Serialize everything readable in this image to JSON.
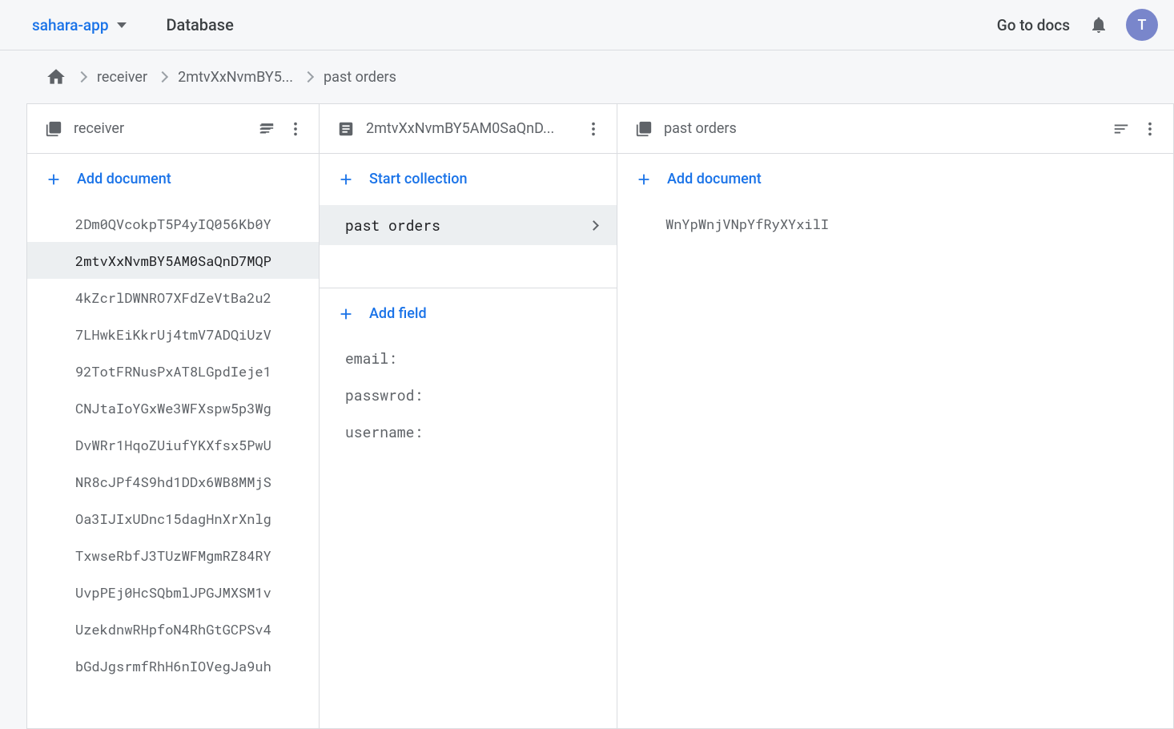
{
  "appbar": {
    "project_name": "sahara-app",
    "page_title": "Database",
    "docs_link": "Go to docs",
    "avatar_initial": "T"
  },
  "breadcrumb": {
    "items": [
      "receiver",
      "2mtvXxNvmBY5...",
      "past orders"
    ]
  },
  "panel0": {
    "title": "receiver",
    "add_label": "Add document",
    "documents": [
      "2Dm0QVcokpT5P4yIQ056Kb0Y",
      "2mtvXxNvmBY5AM0SaQnD7MQP",
      "4kZcrlDWNRO7XFdZeVtBa2u2",
      "7LHwkEiKkrUj4tmV7ADQiUzV",
      "92TotFRNusPxAT8LGpdIeje1",
      "CNJtaIoYGxWe3WFXspw5p3Wg",
      "DvWRr1HqoZUiufYKXfsx5PwU",
      "NR8cJPf4S9hd1DDx6WB8MMjS",
      "Oa3IJIxUDnc15dagHnXrXnlg",
      "TxwseRbfJ3TUzWFMgmRZ84RY",
      "UvpPEj0HcSQbmlJPGJMXSM1v",
      "UzekdnwRHpfoN4RhGtGCPSv4",
      "bGdJgsrmfRhH6nIOVegJa9uh"
    ],
    "selected_index": 1
  },
  "panel1": {
    "title": "2mtvXxNvmBY5AM0SaQnD...",
    "start_collection_label": "Start collection",
    "collections": [
      "past orders"
    ],
    "selected_collection_index": 0,
    "add_field_label": "Add field",
    "fields": [
      "email:",
      "passwrod:",
      "username:"
    ]
  },
  "panel2": {
    "title": "past orders",
    "add_label": "Add document",
    "documents": [
      "WnYpWnjVNpYfRyXYxilI"
    ]
  }
}
